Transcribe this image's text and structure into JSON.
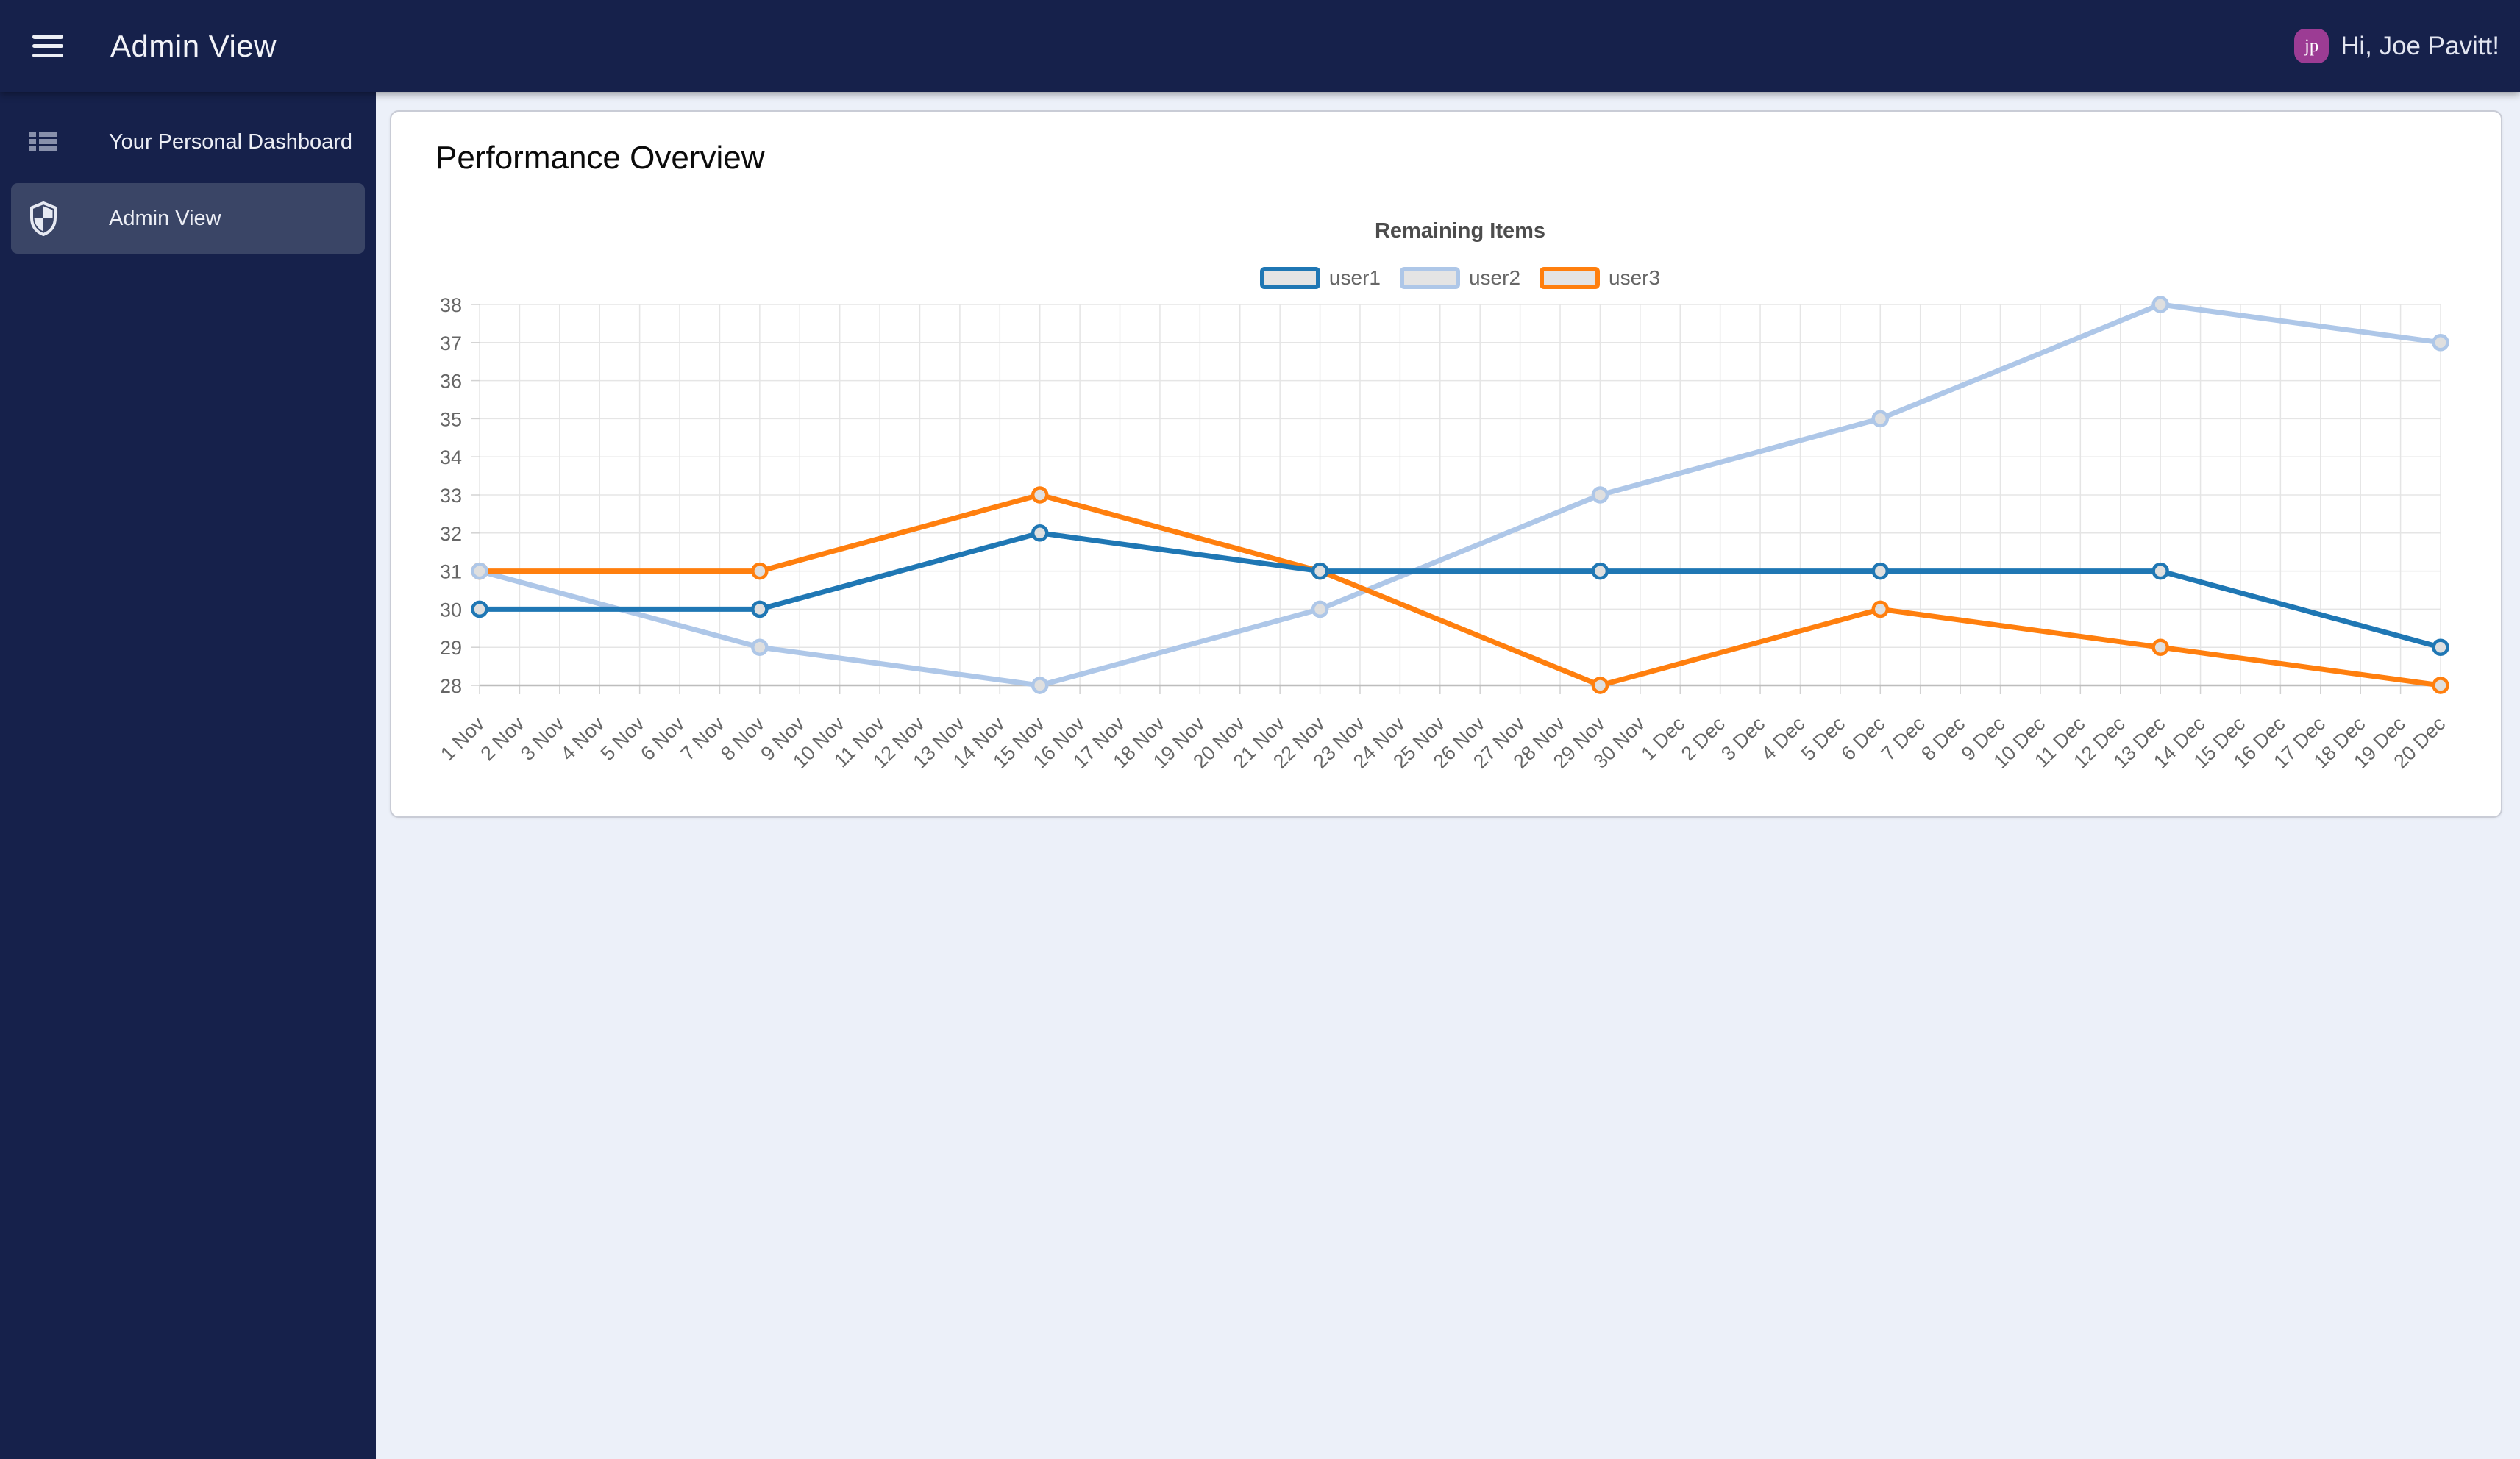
{
  "topbar": {
    "title": "Admin View",
    "greeting": "Hi, Joe Pavitt!",
    "avatar_initials": "jp",
    "avatar_color": "#9C3C94",
    "background": "#16214B"
  },
  "sidebar": {
    "background": "#16214B",
    "active_background": "#3A4566",
    "items": [
      {
        "label": "Your Personal Dashboard",
        "icon": "dashboard-list-icon",
        "active": false
      },
      {
        "label": "Admin View",
        "icon": "shield-icon",
        "active": true
      }
    ]
  },
  "main": {
    "background": "#ECF0F9",
    "card": {
      "title": "Performance Overview",
      "background": "#FFFFFF"
    }
  },
  "chart_data": {
    "type": "line",
    "title": "Remaining Items",
    "legend_position": "top",
    "grid": true,
    "y_axis": {
      "min": 28,
      "max": 38,
      "ticks": [
        28,
        29,
        30,
        31,
        32,
        33,
        34,
        35,
        36,
        37,
        38
      ]
    },
    "x_axis": {
      "rotation_deg": -45,
      "tick_labels": [
        "1 Nov",
        "2 Nov",
        "3 Nov",
        "4 Nov",
        "5 Nov",
        "6 Nov",
        "7 Nov",
        "8 Nov",
        "9 Nov",
        "10 Nov",
        "11 Nov",
        "12 Nov",
        "13 Nov",
        "14 Nov",
        "15 Nov",
        "16 Nov",
        "17 Nov",
        "18 Nov",
        "19 Nov",
        "20 Nov",
        "21 Nov",
        "22 Nov",
        "23 Nov",
        "24 Nov",
        "25 Nov",
        "26 Nov",
        "27 Nov",
        "28 Nov",
        "29 Nov",
        "30 Nov",
        "1 Dec",
        "2 Dec",
        "3 Dec",
        "4 Dec",
        "5 Dec",
        "6 Dec",
        "7 Dec",
        "8 Dec",
        "9 Dec",
        "10 Dec",
        "11 Dec",
        "12 Dec",
        "13 Dec",
        "14 Dec",
        "15 Dec",
        "16 Dec",
        "17 Dec",
        "18 Dec",
        "19 Dec",
        "20 Dec"
      ]
    },
    "categories": [
      "1 Nov",
      "8 Nov",
      "15 Nov",
      "22 Nov",
      "29 Nov",
      "6 Dec",
      "13 Dec",
      "20 Dec"
    ],
    "series": [
      {
        "name": "user1",
        "color": "#1F77B4",
        "values": [
          30,
          30,
          32,
          31,
          31,
          31,
          31,
          29
        ]
      },
      {
        "name": "user2",
        "color": "#AEC7E8",
        "values": [
          31,
          29,
          28,
          30,
          33,
          35,
          38,
          37
        ]
      },
      {
        "name": "user3",
        "color": "#FF7F0E",
        "values": [
          31,
          31,
          33,
          31,
          28,
          30,
          29,
          28
        ]
      }
    ],
    "marker_fill": "#DFDFDF",
    "gridline_color": "#E5E5E5",
    "axis_line_color": "#BDBDBD",
    "tick_color": "#D2D2D2",
    "label_color": "#666666",
    "title_color": "#4C4C4C"
  }
}
